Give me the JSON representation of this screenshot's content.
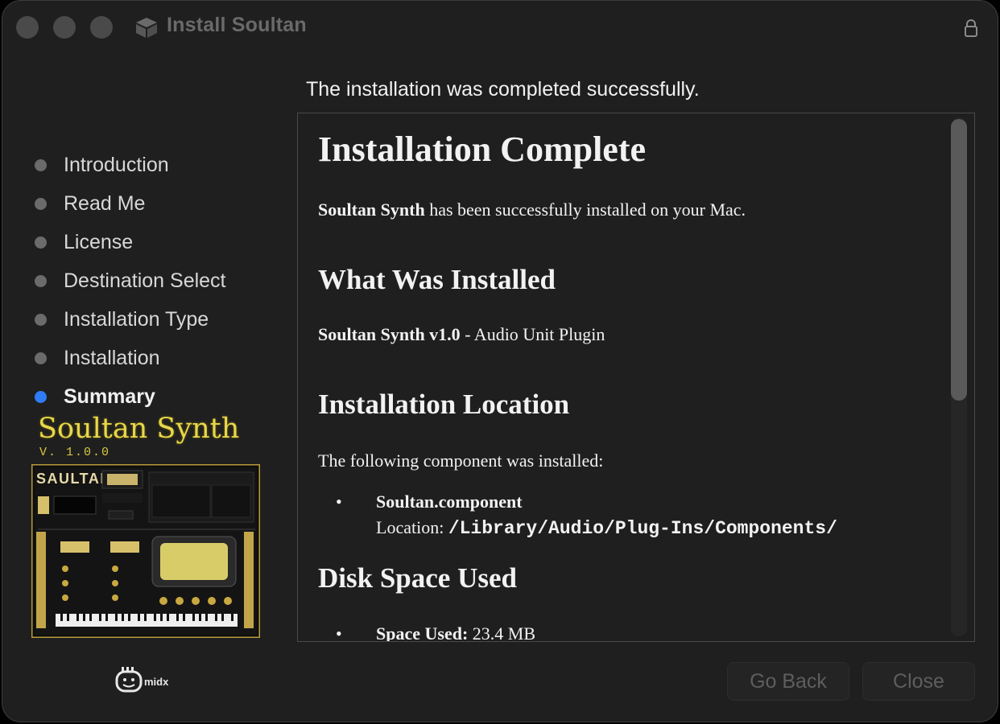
{
  "window": {
    "title": "Install Soultan"
  },
  "heading": "The installation was completed successfully.",
  "steps": [
    {
      "label": "Introduction",
      "active": false
    },
    {
      "label": "Read Me",
      "active": false
    },
    {
      "label": "License",
      "active": false
    },
    {
      "label": "Destination Select",
      "active": false
    },
    {
      "label": "Installation Type",
      "active": false
    },
    {
      "label": "Installation",
      "active": false
    },
    {
      "label": "Summary",
      "active": true
    }
  ],
  "branding": {
    "title": "Soultan Synth",
    "version": "V. 1.0.0",
    "art_logo": "SAULTAN",
    "maker_logo": "midx"
  },
  "content": {
    "title": "Installation Complete",
    "intro_bold": "Soultan Synth",
    "intro_rest": " has been successfully installed on your Mac.",
    "section1_title": "What Was Installed",
    "item_bold": "Soultan Synth v1.0",
    "item_rest": " - Audio Unit Plugin",
    "section2_title": "Installation Location",
    "location_intro": "The following component was installed:",
    "bullet": "•",
    "component_name": "Soultan.component",
    "location_label": "Location: ",
    "location_path": "/Library/Audio/Plug-Ins/Components/",
    "section3_title": "Disk Space Used",
    "space_label": "Space Used:",
    "space_value": " 23.4 MB"
  },
  "buttons": {
    "back": "Go Back",
    "close": "Close"
  },
  "colors": {
    "accent": "#2f7cf6",
    "brand_gold": "#e8d84a",
    "background": "#1f1f1f"
  },
  "icons": {
    "title": "installer-package-icon",
    "lock": "lock-icon"
  }
}
